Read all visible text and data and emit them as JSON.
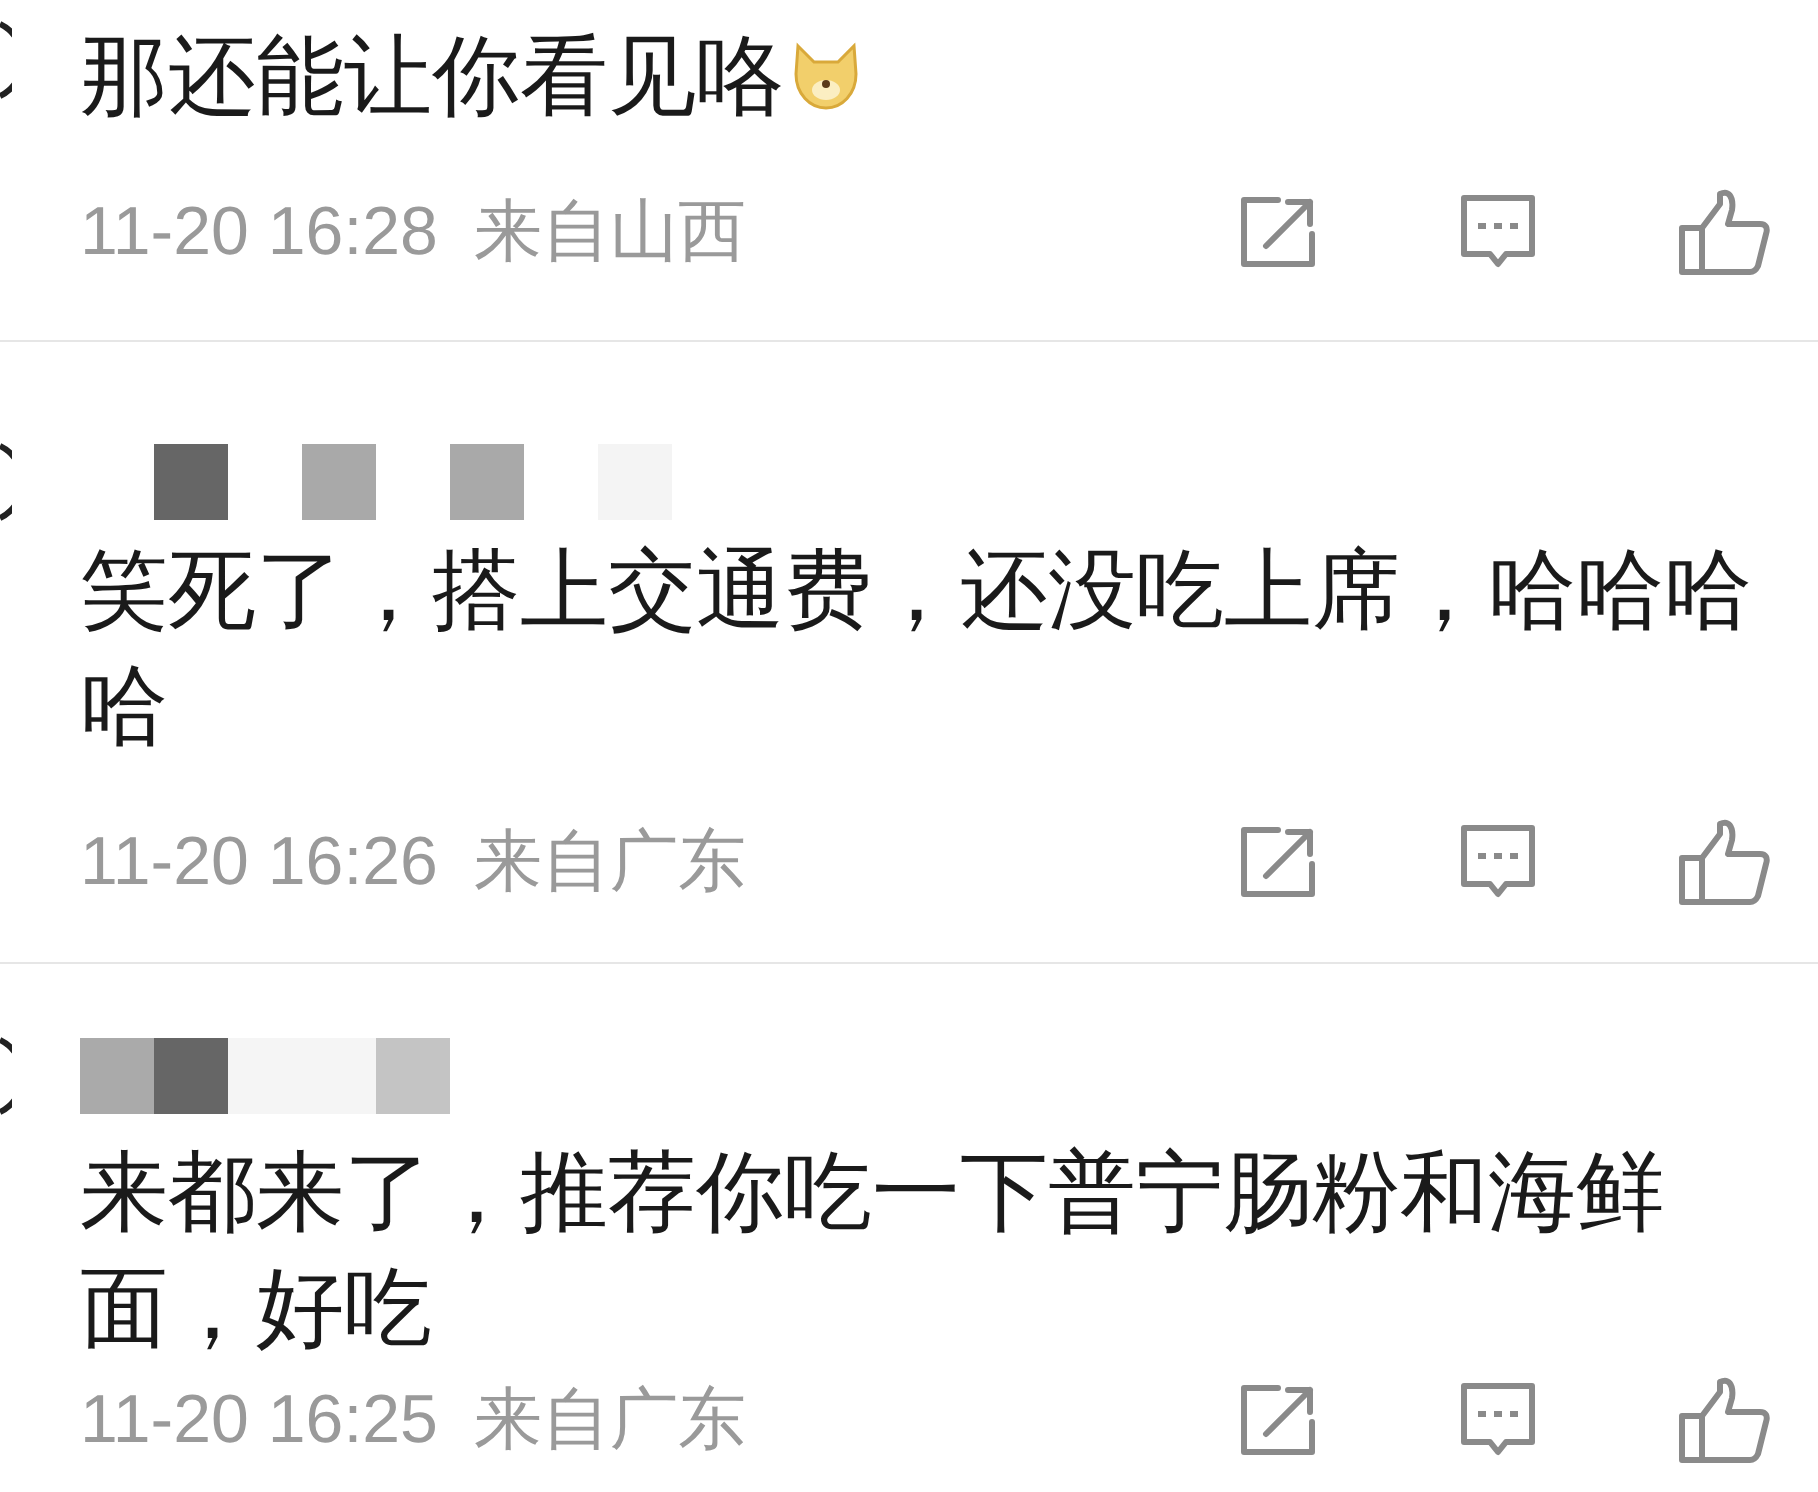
{
  "comments": [
    {
      "text": "那还能让你看见咯",
      "emoji": true,
      "time": "11-20 16:28",
      "location": "来自山西"
    },
    {
      "text": "笑死了，搭上交通费，还没吃上席，哈哈哈哈",
      "emoji": false,
      "time": "11-20 16:26",
      "location": "来自广东"
    },
    {
      "text": "来都来了，推荐你吃一下普宁肠粉和海鲜面，好吃",
      "emoji": false,
      "time": "11-20 16:25",
      "location": "来自广东"
    }
  ]
}
